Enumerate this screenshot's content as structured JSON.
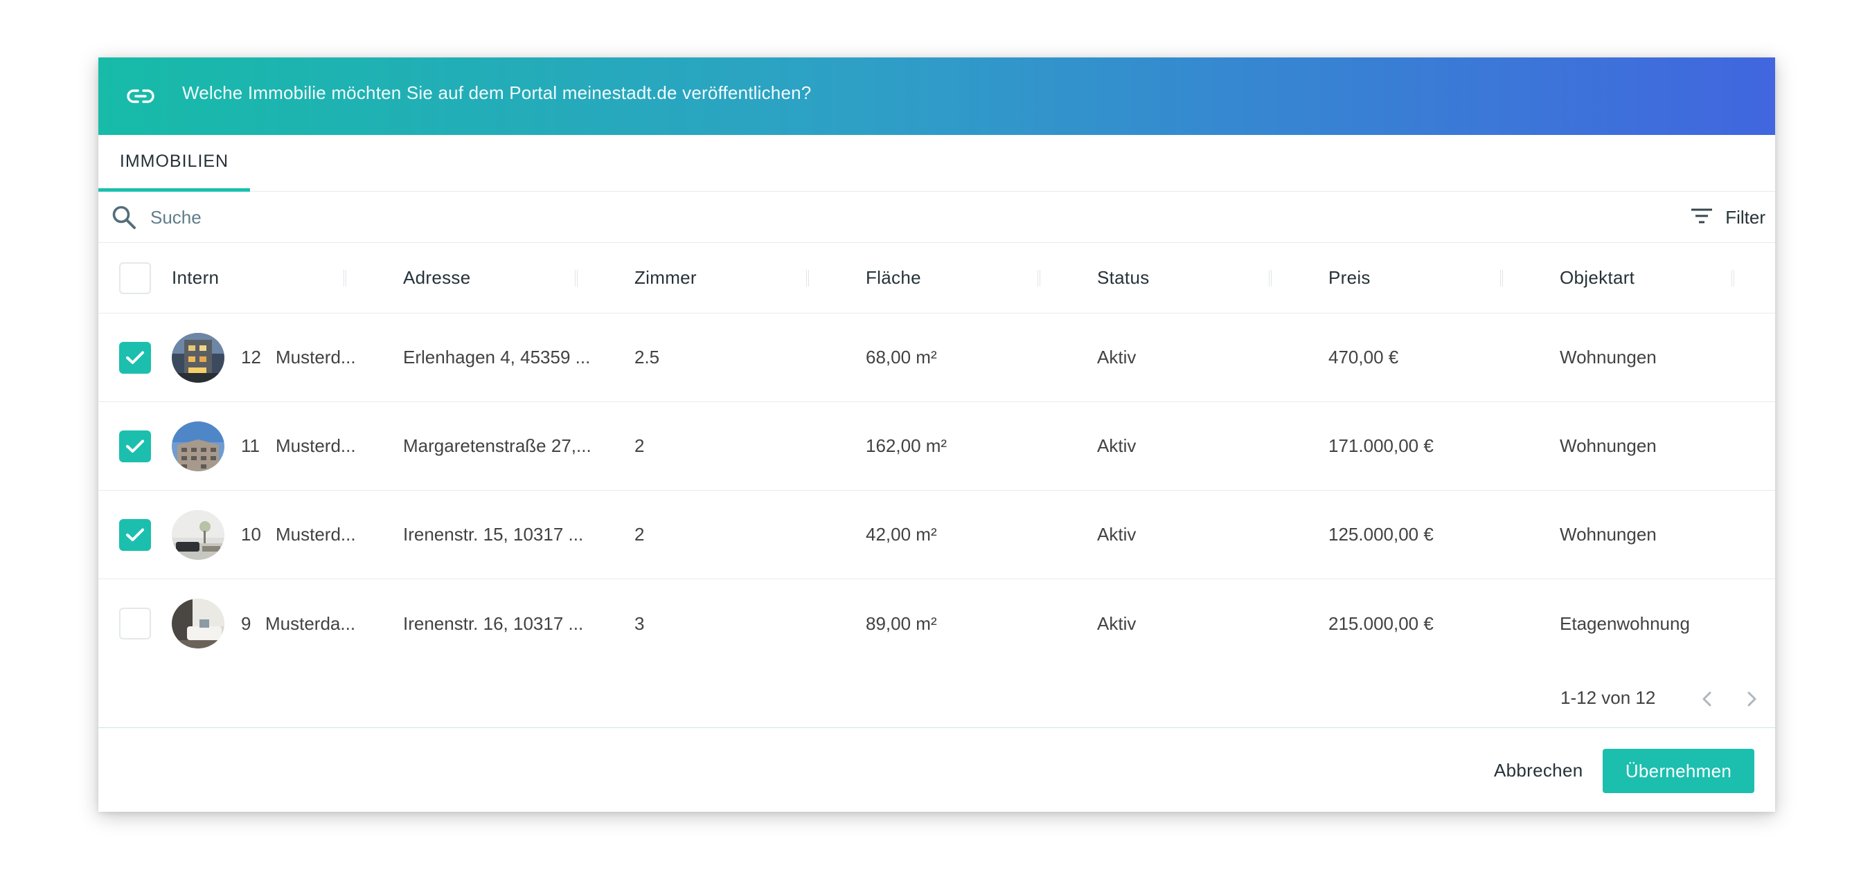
{
  "dialog": {
    "title": "Welche Immobilie möchten Sie auf dem Portal meinestadt.de veröffentlichen?",
    "header_icon": "link-icon"
  },
  "tabs": [
    {
      "label": "IMMOBILIEN",
      "active": true
    }
  ],
  "search": {
    "placeholder": "Suche",
    "value": ""
  },
  "filter": {
    "label": "Filter"
  },
  "columns": [
    "Intern",
    "Adresse",
    "Zimmer",
    "Fläche",
    "Status",
    "Preis",
    "Objektart"
  ],
  "rows": [
    {
      "checked": true,
      "id": "12",
      "name": "Musterd...",
      "address": "Erlenhagen 4, 45359 ...",
      "rooms": "2.5",
      "area": "68,00 m²",
      "status": "Aktiv",
      "price": "470,00 €",
      "type": "Wohnungen"
    },
    {
      "checked": true,
      "id": "11",
      "name": "Musterd...",
      "address": "Margaretenstraße 27,...",
      "rooms": "2",
      "area": "162,00 m²",
      "status": "Aktiv",
      "price": "171.000,00 €",
      "type": "Wohnungen"
    },
    {
      "checked": true,
      "id": "10",
      "name": "Musterd...",
      "address": "Irenenstr. 15, 10317 ...",
      "rooms": "2",
      "area": "42,00 m²",
      "status": "Aktiv",
      "price": "125.000,00 €",
      "type": "Wohnungen"
    },
    {
      "checked": false,
      "id": "9",
      "name": "Musterda...",
      "address": "Irenenstr. 16, 10317 ...",
      "rooms": "3",
      "area": "89,00 m²",
      "status": "Aktiv",
      "price": "215.000,00 €",
      "type": "Etagenwohnung"
    }
  ],
  "pagination": {
    "range": "1-12 von 12"
  },
  "footer": {
    "cancel_label": "Abbrechen",
    "apply_label": "Übernehmen"
  },
  "colors": {
    "accent": "#1cbfae",
    "gradient_start": "#17bba8",
    "gradient_end": "#4166df"
  }
}
